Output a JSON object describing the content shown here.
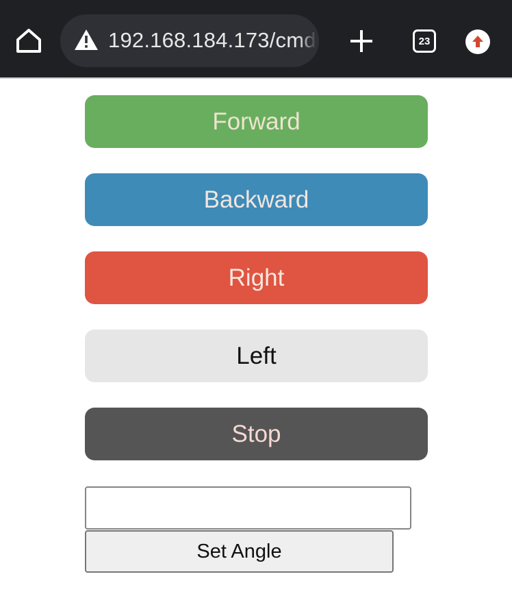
{
  "browser": {
    "url": "192.168.184.173/cmd",
    "tab_count": "23",
    "icons": {
      "home": "home-icon",
      "security": "warning-icon",
      "new_tab": "plus-icon",
      "tabs": "tab-switcher-icon",
      "update": "update-arrow-icon"
    },
    "colors": {
      "toolbar": "#1f2023",
      "urlbar": "#2e3035",
      "update_arrow": "#d6462f"
    }
  },
  "controls": {
    "forward": {
      "label": "Forward",
      "color": "#68ae5e"
    },
    "backward": {
      "label": "Backward",
      "color": "#3e8bb8"
    },
    "right": {
      "label": "Right",
      "color": "#e05442"
    },
    "left": {
      "label": "Left",
      "color": "#e6e6e6"
    },
    "stop": {
      "label": "Stop",
      "color": "#555555"
    }
  },
  "angle": {
    "value": "",
    "placeholder": "",
    "button_label": "Set Angle"
  }
}
